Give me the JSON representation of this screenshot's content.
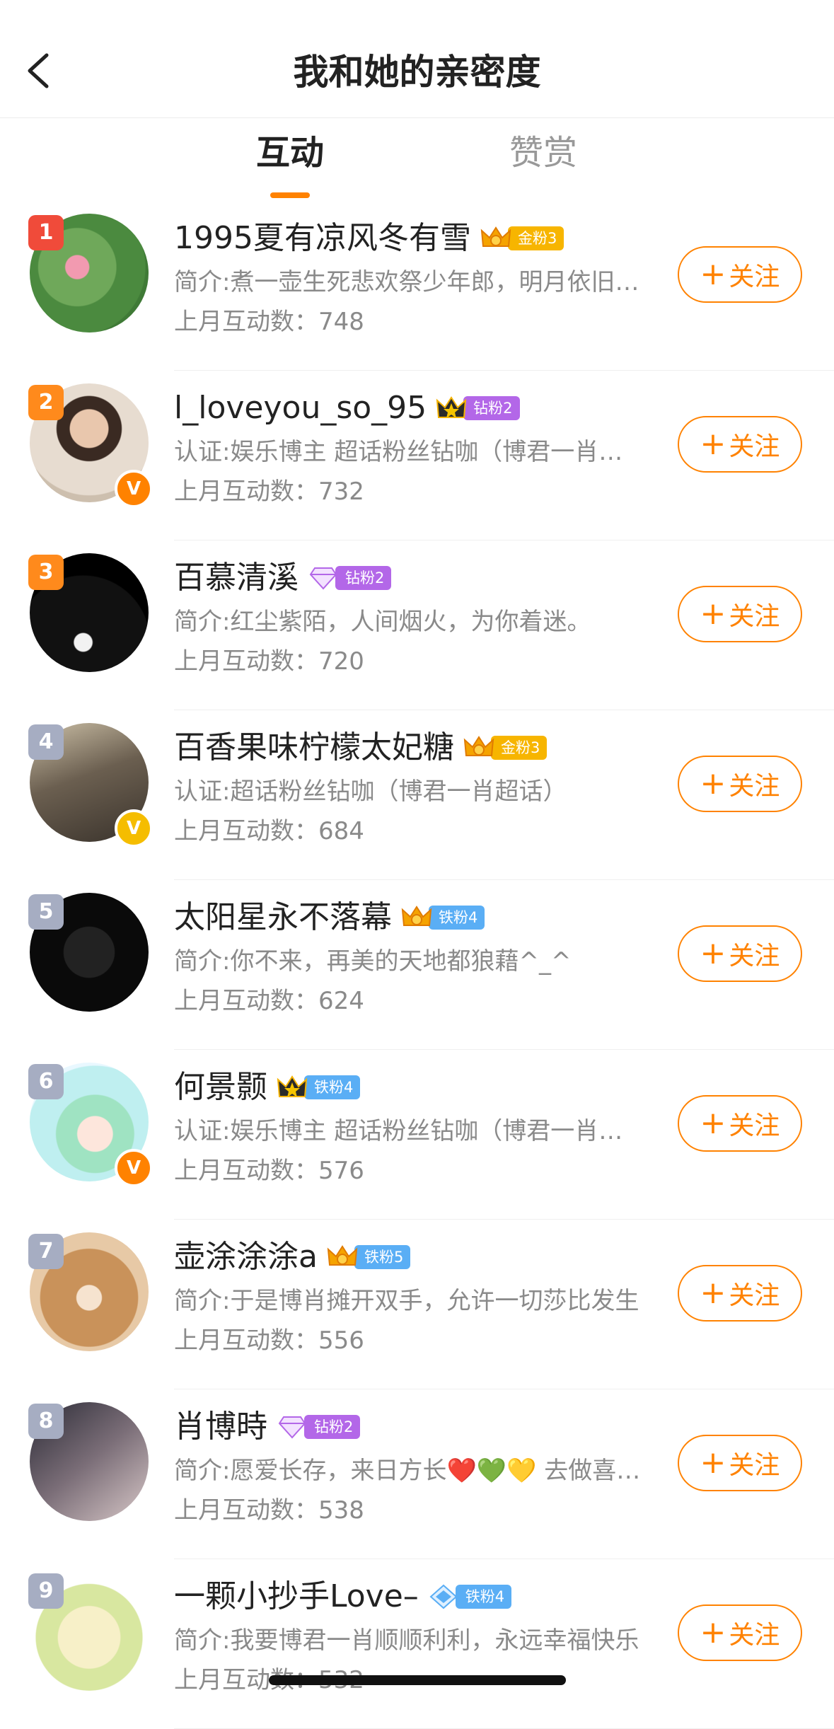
{
  "header": {
    "title": "我和她的亲密度"
  },
  "tabs": [
    {
      "label": "互动"
    },
    {
      "label": "赞赏"
    }
  ],
  "colors": {
    "accent": "#ff8200",
    "rank_red": "#f04b3a",
    "rank_orange": "#ff8a1c",
    "rank_gray": "#a6adc2",
    "gold_fan": "#f7b500",
    "diamond_fan": "#b367e8",
    "iron_fan": "#5aaef5",
    "verified_orange": "#ff8200",
    "verified_gold": "#f5bd00"
  },
  "follow_label": "关注",
  "rows": [
    {
      "rank": "1",
      "name": "1995夏有凉风冬有雪",
      "fan_icon": "crown-gold-icon",
      "fan_label": "金粉3",
      "fan_color": "#f7b500",
      "desc": "简介:煮一壶生死悲欢祭少年郎，明月依旧何来...",
      "count": "上月互动数：748",
      "verified": ""
    },
    {
      "rank": "2",
      "name": "l_loveyou_so_95",
      "fan_icon": "crown-black-icon",
      "fan_label": "钻粉2",
      "fan_color": "#b367e8",
      "desc": "认证:娱乐博主 超话粉丝钻咖（博君一肖超话）",
      "count": "上月互动数：732",
      "verified": "orange"
    },
    {
      "rank": "3",
      "name": "百慕清溪",
      "fan_icon": "diamond-icon",
      "fan_label": "钻粉2",
      "fan_color": "#b367e8",
      "desc": "简介:红尘紫陌，人间烟火，为你着迷。",
      "count": "上月互动数：720",
      "verified": ""
    },
    {
      "rank": "4",
      "name": "百香果味柠檬太妃糖",
      "fan_icon": "crown-gold-icon",
      "fan_label": "金粉3",
      "fan_color": "#f7b500",
      "desc": "认证:超话粉丝钻咖（博君一肖超话）",
      "count": "上月互动数：684",
      "verified": "gold"
    },
    {
      "rank": "5",
      "name": "太阳星永不落幕",
      "fan_icon": "crown-gold-icon",
      "fan_label": "铁粉4",
      "fan_color": "#5aaef5",
      "desc": "简介:你不来，再美的天地都狼藉^_^",
      "count": "上月互动数：624",
      "verified": ""
    },
    {
      "rank": "6",
      "name": "何景颢",
      "fan_icon": "crown-black-icon",
      "fan_label": "铁粉4",
      "fan_color": "#5aaef5",
      "desc": "认证:娱乐博主 超话粉丝钻咖（博君一肖超话）",
      "count": "上月互动数：576",
      "verified": "orange"
    },
    {
      "rank": "7",
      "name": "壶涂涂涂a",
      "fan_icon": "crown-gold-icon",
      "fan_label": "铁粉5",
      "fan_color": "#5aaef5",
      "desc": "简介:于是博肖摊开双手，允许一切莎比发生",
      "count": "上月互动数：556",
      "verified": ""
    },
    {
      "rank": "8",
      "name": "肖博時",
      "fan_icon": "diamond-icon",
      "fan_label": "钻粉2",
      "fan_color": "#b367e8",
      "desc": "简介:愿爱长存，来日方长❤️💚💛 去做喜欢的事",
      "count": "上月互动数：538",
      "verified": ""
    },
    {
      "rank": "9",
      "name": "一颗小抄手Love–",
      "fan_icon": "diamond-blue-icon",
      "fan_label": "铁粉4",
      "fan_color": "#5aaef5",
      "desc": "简介:我要博君一肖顺顺利利，永远幸福快乐",
      "count": "上月互动数：532",
      "verified": ""
    }
  ]
}
